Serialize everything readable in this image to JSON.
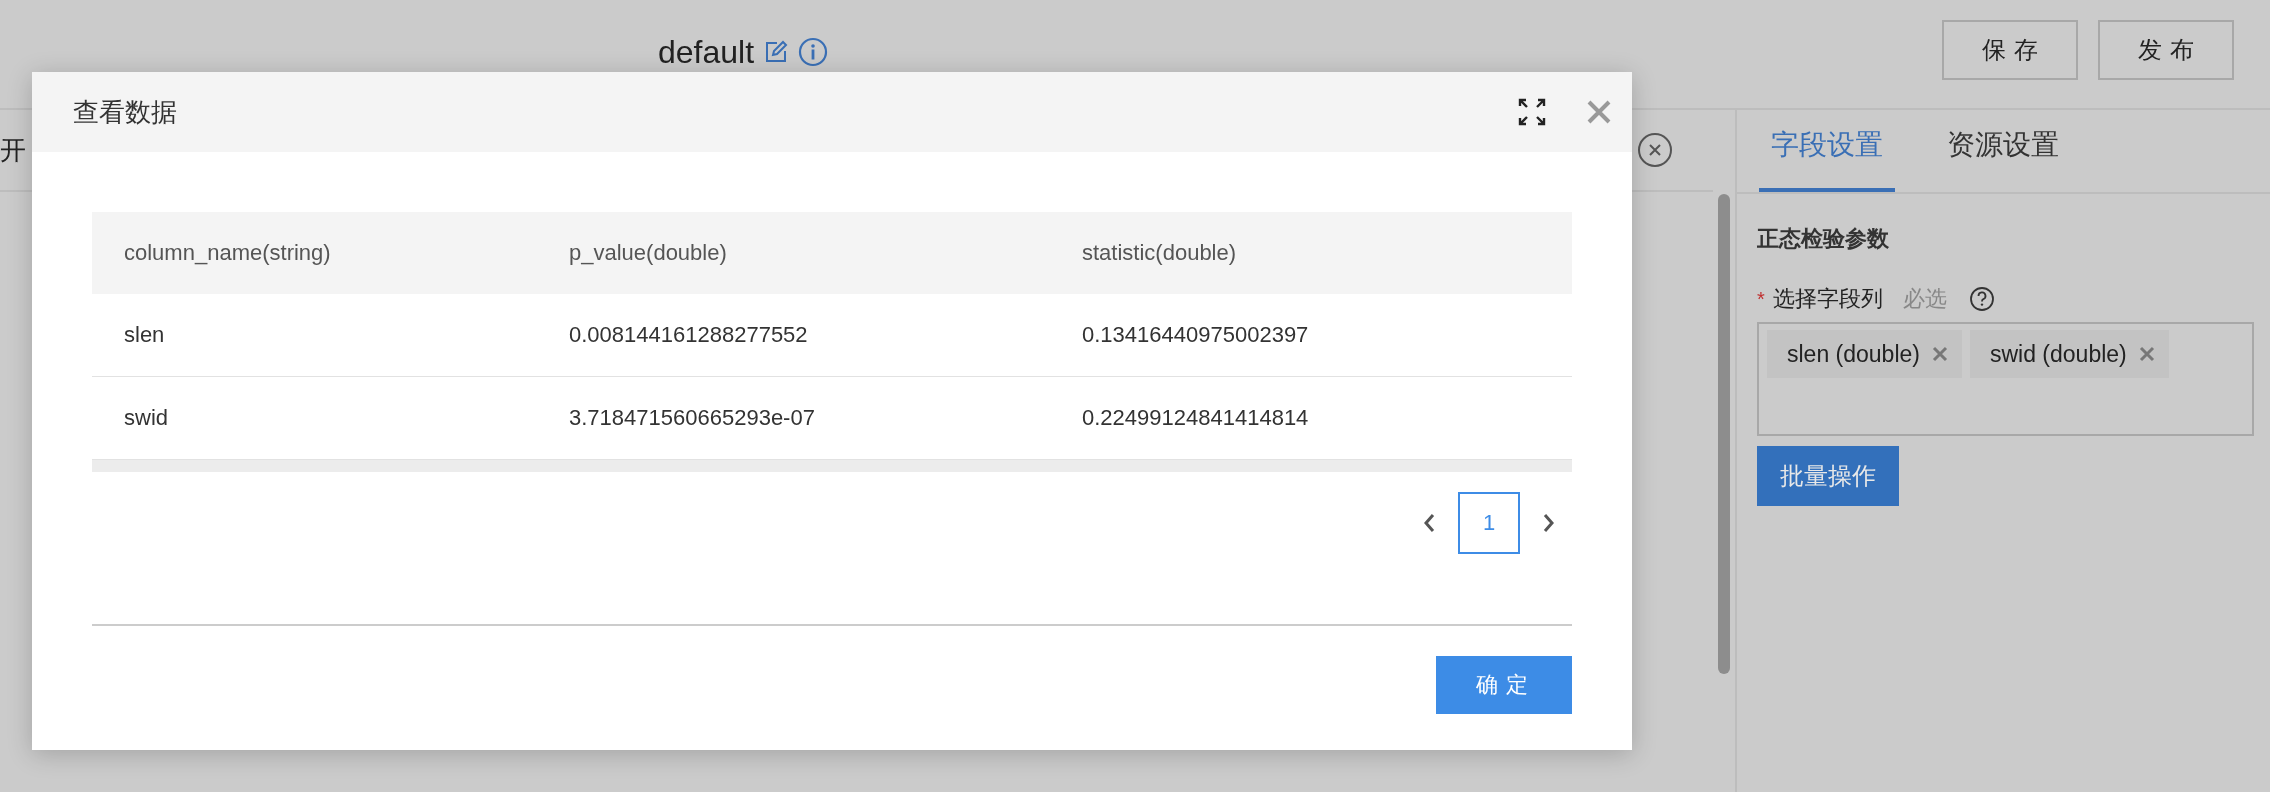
{
  "header": {
    "title": "default",
    "buttons": [
      "保存",
      "发布"
    ]
  },
  "canvas": {
    "toolbar_text": "开"
  },
  "side_panel": {
    "tabs": [
      {
        "label": "字段设置",
        "selected": true
      },
      {
        "label": "资源设置",
        "selected": false
      }
    ],
    "section_title": "正态检验参数",
    "field": {
      "label": "选择字段列",
      "required": true,
      "required_mark": "*",
      "hint": "必选",
      "tags": [
        "slen (double)",
        "swid (double)"
      ]
    },
    "batch_button": "批量操作"
  },
  "dialog": {
    "title": "查看数据",
    "table": {
      "columns": [
        "column_name(string)",
        "p_value(double)",
        "statistic(double)"
      ],
      "rows": [
        [
          "slen",
          "0.008144161288277552",
          "0.13416440975002397"
        ],
        [
          "swid",
          "3.718471560665293e-07",
          "0.22499124841414814"
        ]
      ]
    },
    "pagination": {
      "pages": [
        {
          "label": "1",
          "selected": true
        }
      ]
    },
    "ok_button": "确定"
  }
}
